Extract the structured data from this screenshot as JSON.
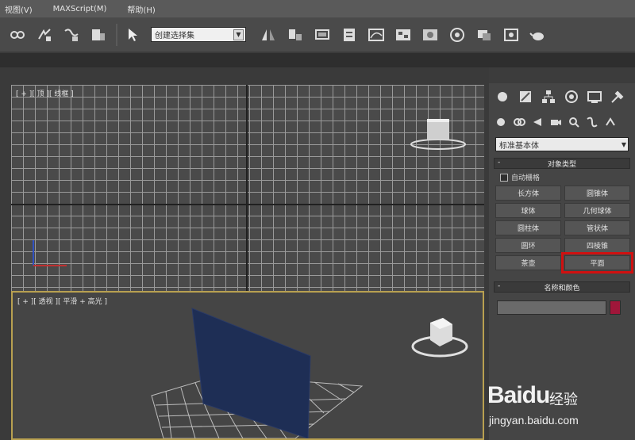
{
  "menu": {
    "items": [
      "视图(V)",
      "MAXScript(M)",
      "帮助(H)"
    ]
  },
  "toolbar": {
    "selection_set": "创建选择集",
    "icons": [
      "link-icon",
      "unlink-icon",
      "bind-spacewarp-icon",
      "select-filter-icon",
      "select-object-icon",
      "select-by-name-icon",
      "region-select-icon",
      "move-icon",
      "rotate-icon",
      "scale-icon",
      "mirror-icon",
      "align-icon",
      "layer-icon",
      "curve-editor-icon",
      "schematic-icon",
      "material-editor-icon",
      "render-setup-icon",
      "render-frame-icon",
      "render-icon"
    ]
  },
  "viewports": {
    "top_label": "[ + ][ 顶 ][ 线框 ]",
    "perspective_label": "[ + ][ 透视 ][ 平滑 + 高光 ]"
  },
  "command_panel": {
    "category": "标准基本体",
    "object_type_header": "对象类型",
    "autogrid_label": "自动栅格",
    "buttons": [
      {
        "label": "长方体",
        "highlight": false
      },
      {
        "label": "圆锥体",
        "highlight": false
      },
      {
        "label": "球体",
        "highlight": false
      },
      {
        "label": "几何球体",
        "highlight": false
      },
      {
        "label": "圆柱体",
        "highlight": false
      },
      {
        "label": "管状体",
        "highlight": false
      },
      {
        "label": "圆环",
        "highlight": false
      },
      {
        "label": "四棱锥",
        "highlight": false
      },
      {
        "label": "茶壶",
        "highlight": false
      },
      {
        "label": "平面",
        "highlight": true
      }
    ],
    "name_color_header": "名称和颜色",
    "color_swatch": "#a0163a"
  },
  "watermark": {
    "logo": "Baidu",
    "suffix": "经验",
    "url": "jingyan.baidu.com"
  },
  "colors": {
    "highlight_outline": "#d01010",
    "viewport_active_border": "#b8a050",
    "plane_object": "#1e2e55"
  }
}
